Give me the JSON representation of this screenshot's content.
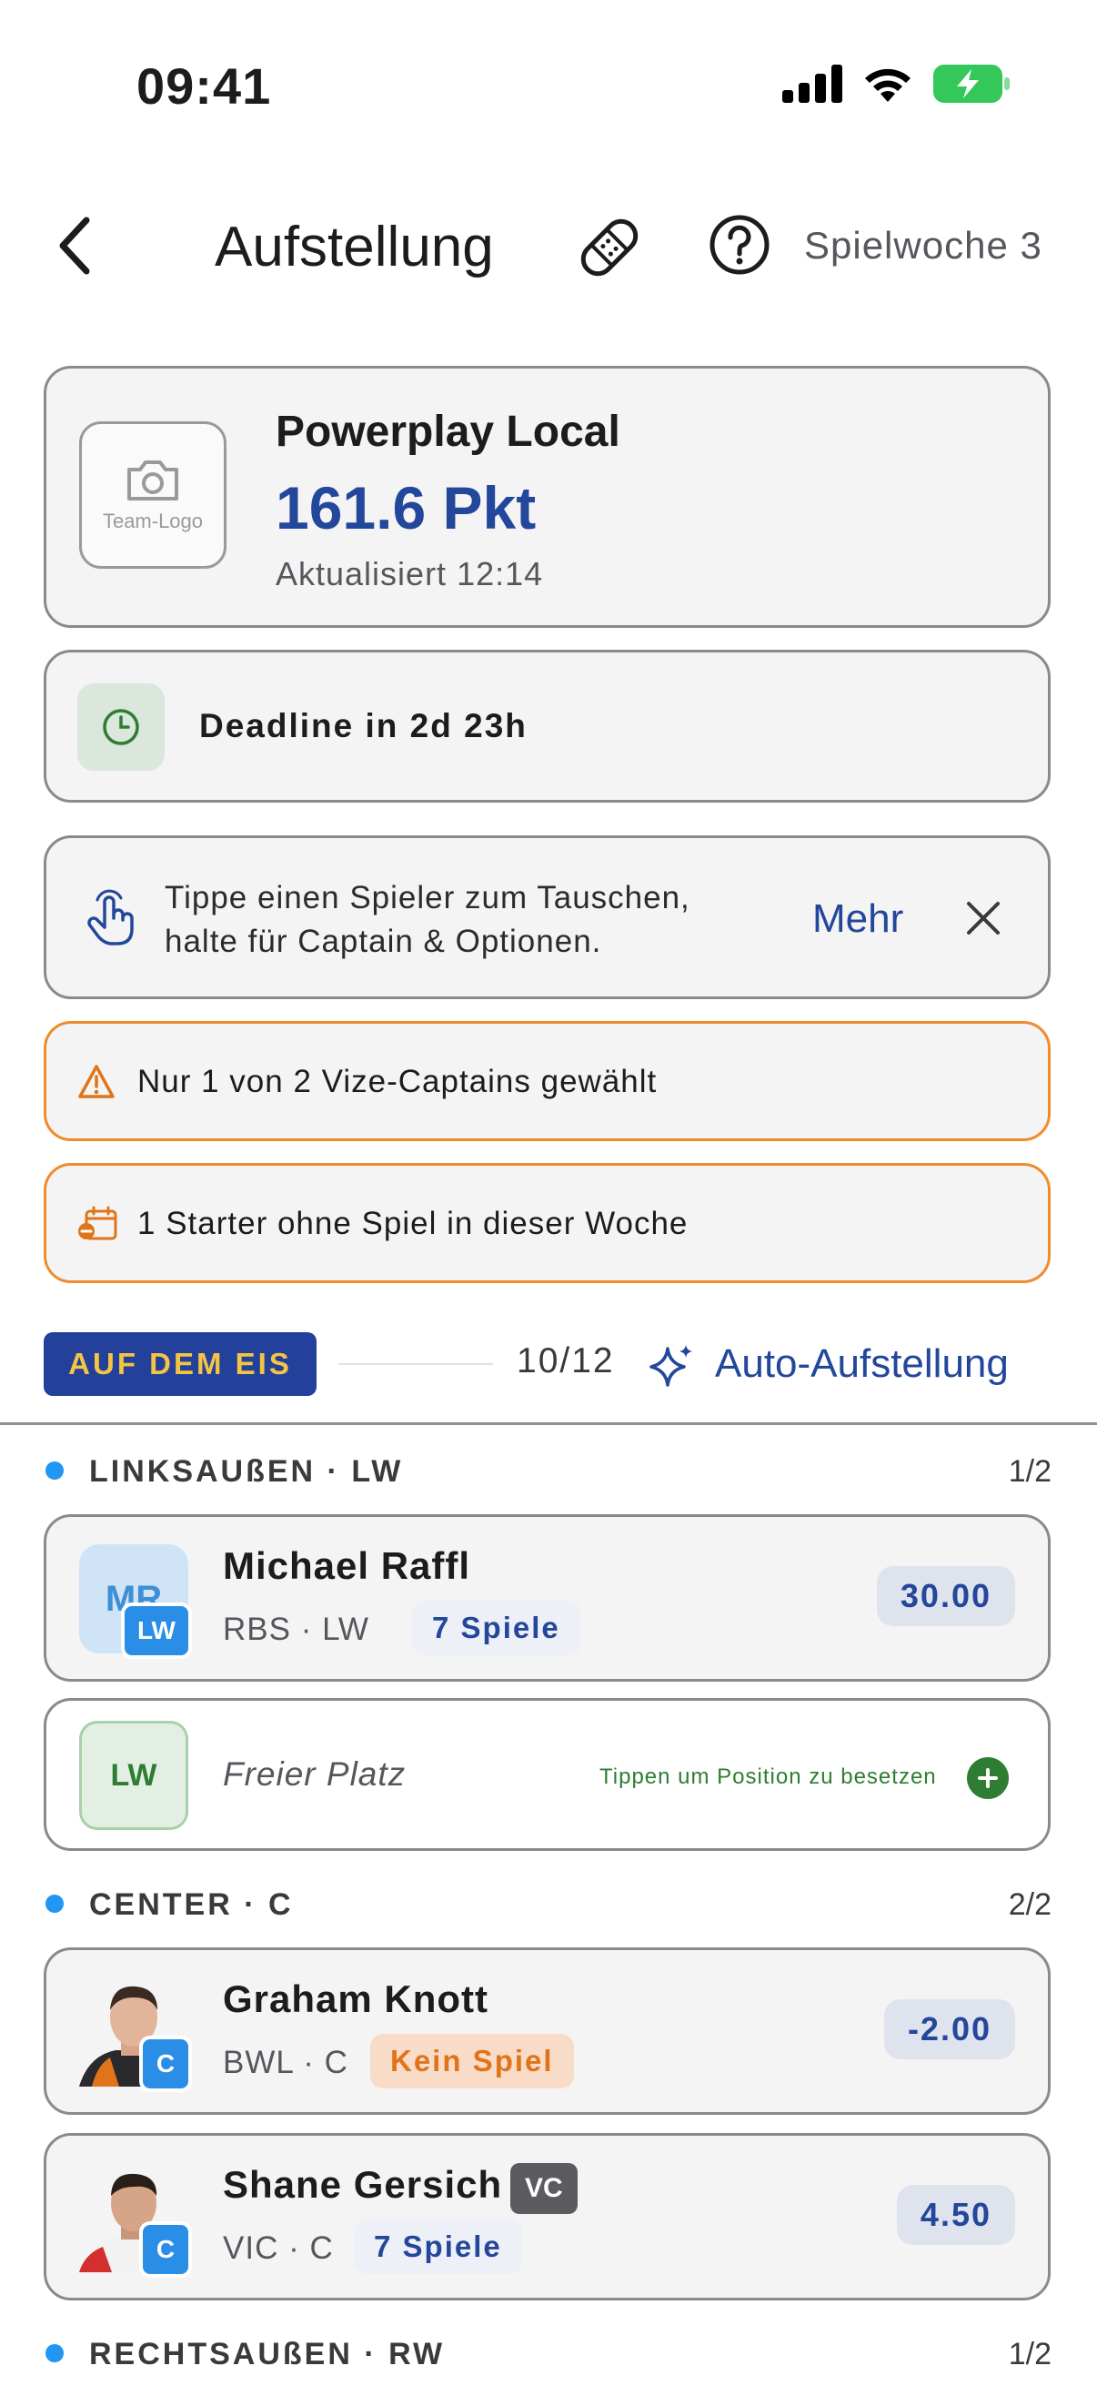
{
  "status_bar": {
    "time": "09:41"
  },
  "header": {
    "title": "Aufstellung",
    "week": "Spielwoche 3"
  },
  "team": {
    "logo_label": "Team-Logo",
    "name": "Powerplay Local",
    "points": "161.6 Pkt",
    "updated": "Aktualisiert 12:14"
  },
  "deadline": {
    "text": "Deadline in 2d 23h"
  },
  "hint": {
    "line1": "Tippe einen Spieler zum Tauschen,",
    "line2": "halte für Captain & Optionen.",
    "more": "Mehr"
  },
  "warnings": [
    {
      "icon": "warning-triangle-icon",
      "text": "Nur 1 von 2 Vize-Captains gewählt"
    },
    {
      "icon": "calendar-off-icon",
      "text": "1 Starter ohne Spiel in dieser Woche"
    }
  ],
  "lineup_bar": {
    "badge": "AUF DEM EIS",
    "count": "10/12",
    "auto": "Auto-Aufstellung"
  },
  "positions": {
    "lw": {
      "title": "LINKSAUßEN · LW",
      "count": "1/2",
      "player": {
        "initials": "MR",
        "badge": "LW",
        "name": "Michael Raffl",
        "meta": "RBS · LW",
        "tag": "7 Spiele",
        "score": "30.00"
      },
      "empty": {
        "pos": "LW",
        "label": "Freier Platz",
        "hint": "Tippen um Position zu besetzen"
      }
    },
    "c": {
      "title": "CENTER · C",
      "count": "2/2",
      "players": [
        {
          "badge": "C",
          "name": "Graham Knott",
          "meta": "BWL · C",
          "tag": "Kein Spiel",
          "score": "-2.00"
        },
        {
          "badge": "C",
          "name": "Shane Gersich",
          "vc": "VC",
          "meta": "VIC · C",
          "tag": "7 Spiele",
          "score": "4.50"
        }
      ]
    },
    "rw": {
      "title": "RECHTSAUßEN · RW",
      "count": "1/2"
    }
  },
  "colors": {
    "accent": "#23479a",
    "warning_border": "#f08a2c",
    "ice_badge_bg": "#23409a",
    "ice_badge_text": "#f4c542",
    "position_dot": "#2196f3",
    "empty_green": "#2e7d32"
  }
}
